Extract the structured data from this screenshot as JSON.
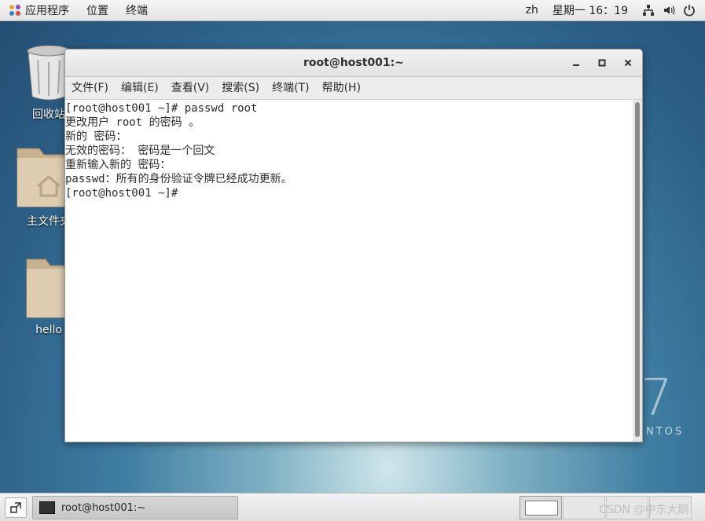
{
  "topbar": {
    "applications": "应用程序",
    "places": "位置",
    "terminal": "终端",
    "language": "zh",
    "clock": "星期一 16：19",
    "icons": [
      "network-icon",
      "volume-icon",
      "power-icon"
    ]
  },
  "desktop": {
    "trash_label": "回收站",
    "home_label": "主文件夹",
    "hello_label": "hello",
    "centos_version": "7",
    "centos_text": "NTOS"
  },
  "window": {
    "title": "root@host001:~",
    "menu": [
      "文件(F)",
      "编辑(E)",
      "查看(V)",
      "搜索(S)",
      "终端(T)",
      "帮助(H)"
    ],
    "lines": [
      "[root@host001 ~]# passwd root",
      "更改用户 root 的密码 。",
      "新的 密码：",
      "无效的密码： 密码是一个回文",
      "重新输入新的 密码：",
      "passwd：所有的身份验证令牌已经成功更新。",
      "[root@host001 ~]# "
    ]
  },
  "taskbar": {
    "task_label": "root@host001:~",
    "watermark": "CSDN @中东大鹅"
  }
}
